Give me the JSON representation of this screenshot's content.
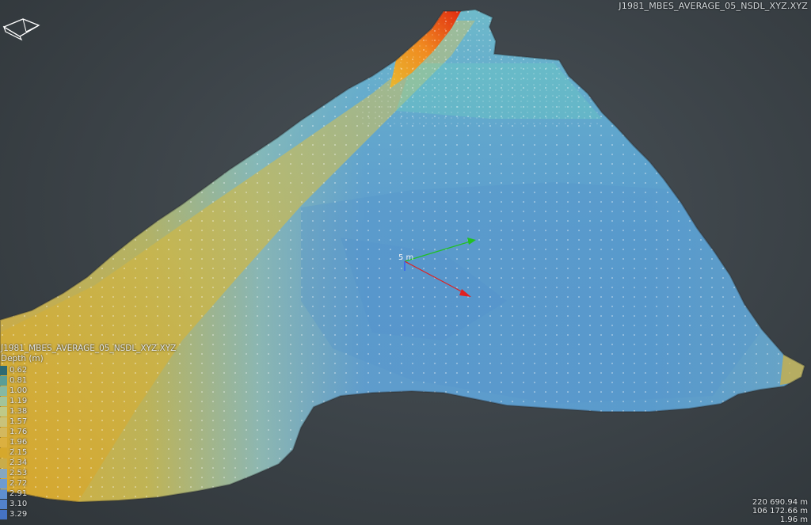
{
  "viewer": {
    "dataset_title": "J1981_MBES_AVERAGE_05_NSDL_XYZ.XYZ",
    "nav_cube_icon": "navigation-cube-icon",
    "axis_gizmo": {
      "label": "5 m",
      "x_color": "#e02020",
      "y_color": "#20c020",
      "z_color": "#2040ff"
    }
  },
  "legend": {
    "title": "J1981_MBES_AVERAGE_05_NSDL_XYZ.XYZ",
    "subtitle": "Depth (m)",
    "entries": [
      {
        "value": "0.62",
        "color": "#2e6a72"
      },
      {
        "value": "0.81",
        "color": "#5a9e96"
      },
      {
        "value": "1.00",
        "color": "#86b9a2"
      },
      {
        "value": "1.19",
        "color": "#a3c49a"
      },
      {
        "value": "1.38",
        "color": "#bfc988"
      },
      {
        "value": "1.57",
        "color": "#c9c27a"
      },
      {
        "value": "1.76",
        "color": "#d3b85e"
      },
      {
        "value": "1.96",
        "color": "#dbb040"
      },
      {
        "value": "2.15",
        "color": "#d6a82c"
      },
      {
        "value": "2.34",
        "color": "#c9ac4a"
      },
      {
        "value": "2.53",
        "color": "#86a7bf"
      },
      {
        "value": "2.72",
        "color": "#6e9bd0"
      },
      {
        "value": "2.91",
        "color": "#5f8fd0"
      },
      {
        "value": "3.10",
        "color": "#5282cc"
      },
      {
        "value": "3.29",
        "color": "#4573c4"
      }
    ]
  },
  "coordinates": {
    "x": "220 690.94 m",
    "y": "106 172.66 m",
    "z": "1.96 m"
  }
}
